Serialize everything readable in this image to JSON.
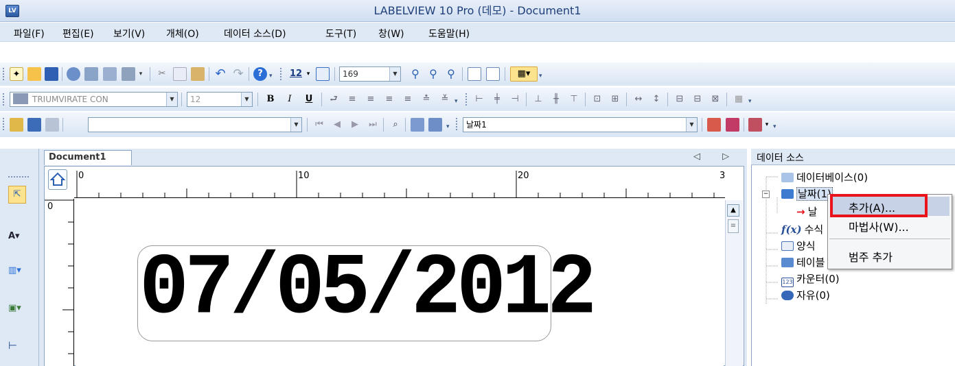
{
  "window": {
    "title": "LABELVIEW 10 Pro (데모) - Document1",
    "app_icon": "LV"
  },
  "menu": [
    "파일(F)",
    "편집(E)",
    "보기(V)",
    "개체(O)",
    "데이터 소스(D)",
    "도구(T)",
    "창(W)",
    "도움말(H)"
  ],
  "toolbar1": {
    "grid_size": "12",
    "zoom": "169"
  },
  "toolbar2": {
    "font_name": "TRIUMVIRATE CON",
    "font_size": "12",
    "bold": "B",
    "italic": "I",
    "underline": "U"
  },
  "toolbar3": {
    "record_select": "",
    "variable_select": "날짜1"
  },
  "document": {
    "tab_label": "Document1",
    "controls": "◁ ▷ ✕",
    "ruler_h_labels": [
      "0",
      "10",
      "20",
      "3"
    ],
    "ruler_v_label": "0",
    "date_value": "07/05/2012"
  },
  "panel": {
    "title": "데이터 소스",
    "items": [
      {
        "label": "데이터베이스(0)",
        "icon": "database-icon"
      },
      {
        "label": "날짜(1)",
        "icon": "date-icon"
      },
      {
        "label": "날",
        "icon": "arrow-icon"
      },
      {
        "label": "수식",
        "icon": "formula-icon"
      },
      {
        "label": "양식",
        "icon": "form-icon"
      },
      {
        "label": "테이블",
        "icon": "table-icon"
      },
      {
        "label": "카운터(0)",
        "icon": "counter-icon"
      },
      {
        "label": "자유(0)",
        "icon": "free-icon"
      }
    ]
  },
  "context_menu": {
    "items": [
      "추가(A)...",
      "마법사(W)...",
      "범주 추가"
    ]
  },
  "colors": {
    "highlight": "#e8131b",
    "title_text": "#1f3f7a"
  }
}
